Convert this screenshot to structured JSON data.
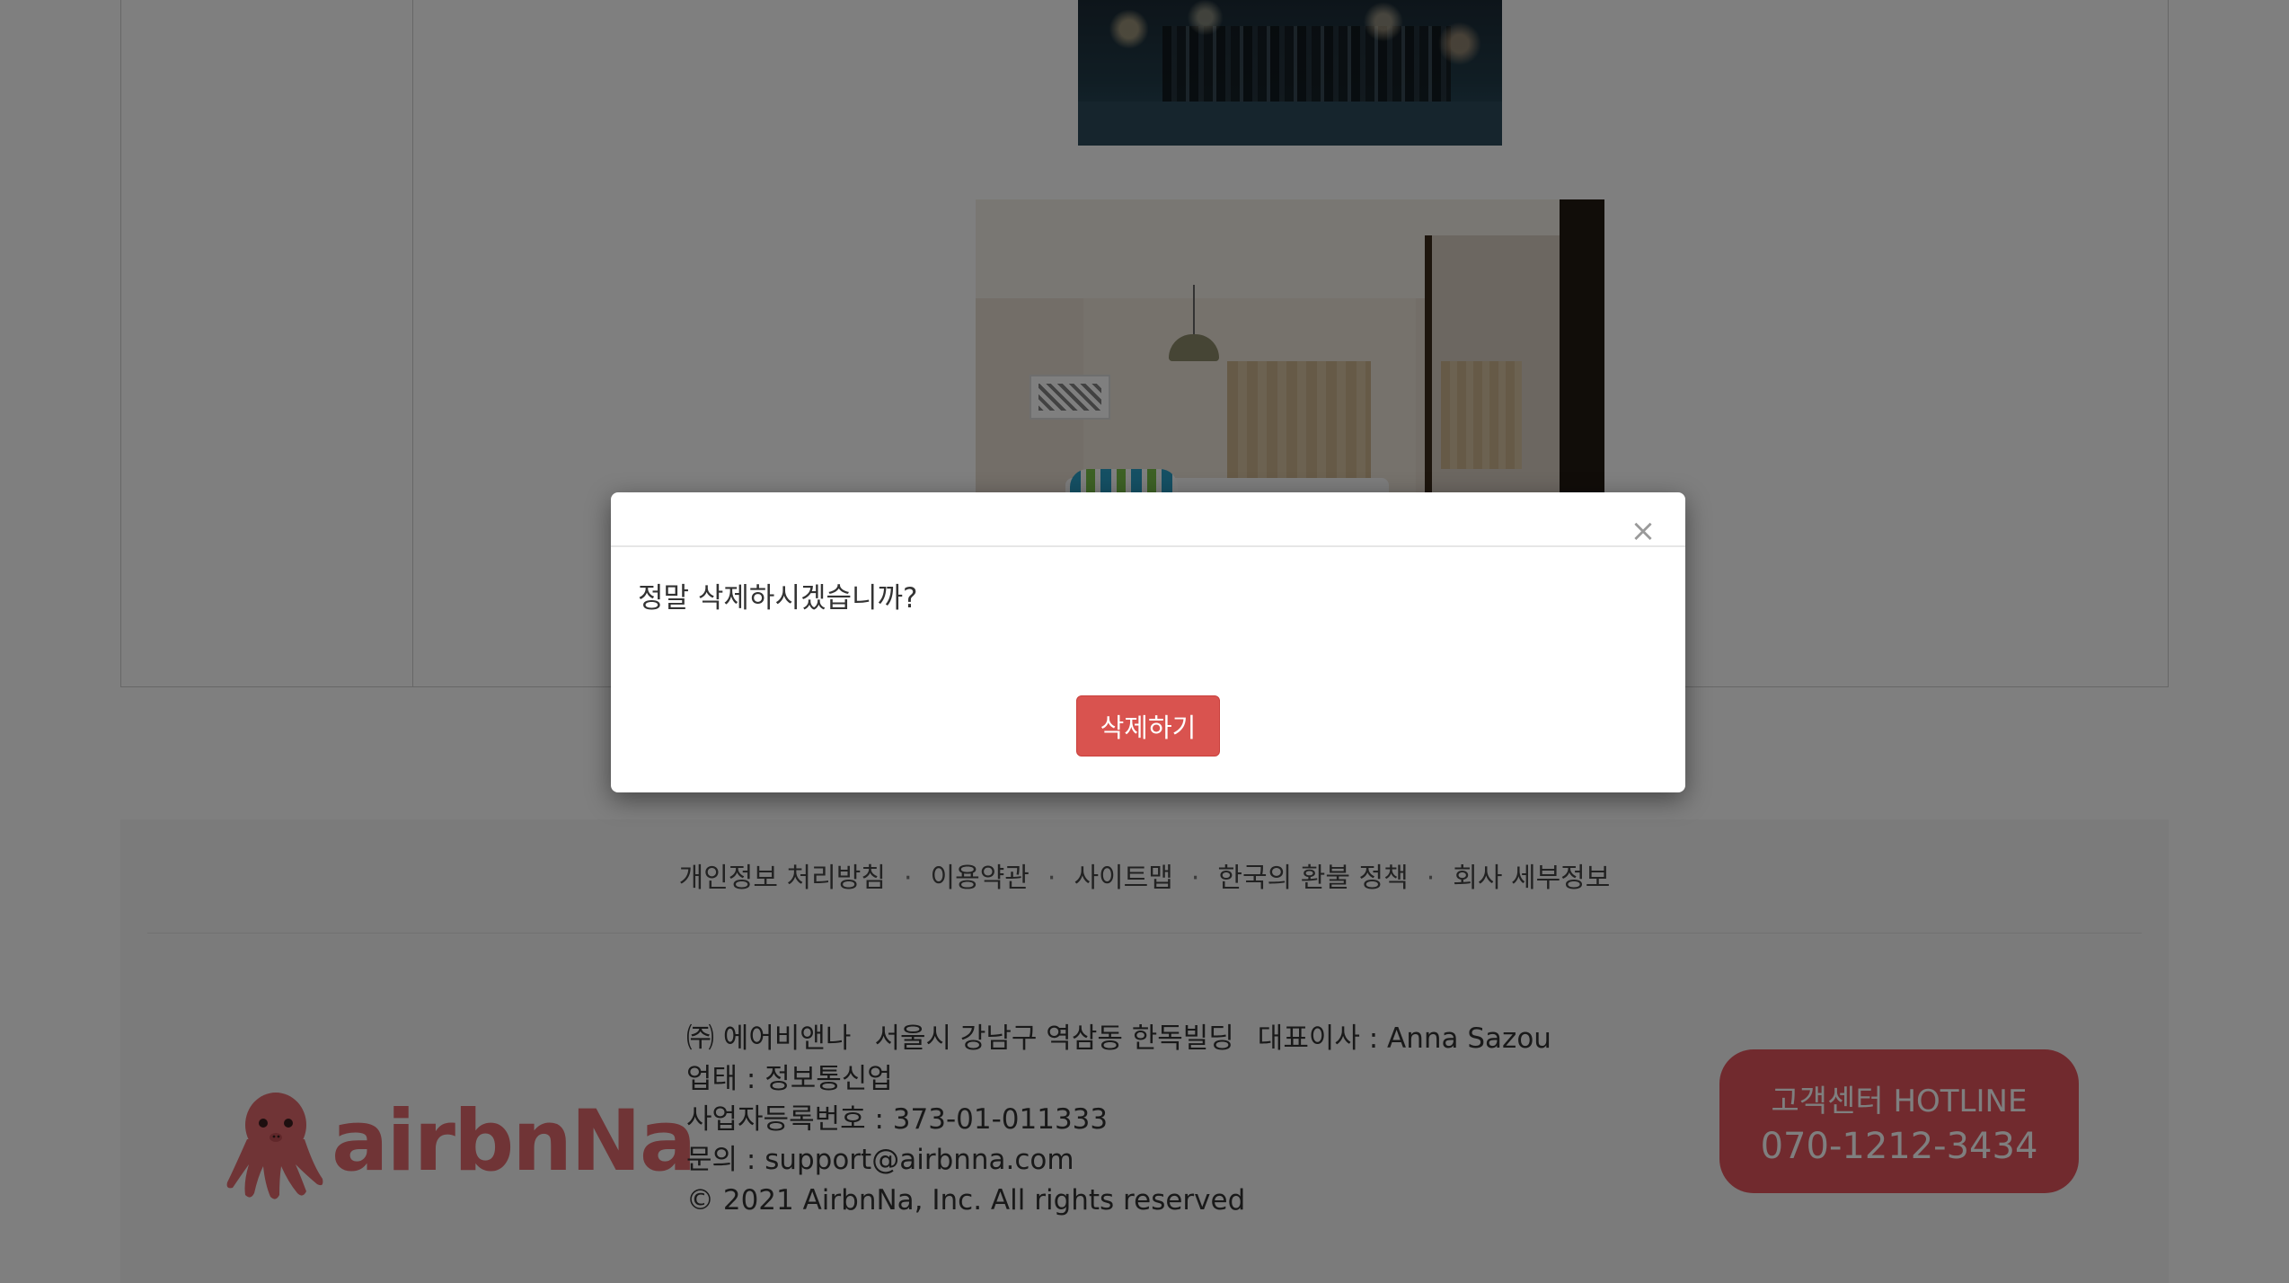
{
  "footer": {
    "links": [
      "개인정보 처리방침",
      "이용약관",
      "사이트맵",
      "한국의 환불 정책",
      "회사 세부정보"
    ],
    "link_separator": "·",
    "company": {
      "line1_name": "㈜ 에어비앤나",
      "line1_address": "서울시 강남구 역삼동 한독빌딩",
      "line1_ceo": "대표이사 : Anna Sazou",
      "business_type": "업태 : 정보통신업",
      "registration": "사업자등록번호 : 373-01-011333",
      "contact": "문의 : support@airbnna.com",
      "copyright": "© 2021 AirbnNa, Inc. All rights reserved"
    },
    "logo_text": "airbnNa",
    "hotline": {
      "label": "고객센터 HOTLINE",
      "number": "070-1212-3434"
    }
  },
  "modal": {
    "close_symbol": "×",
    "message": "정말 삭제하시겠습니까?",
    "confirm_label": "삭제하기",
    "confirm_color": "#d9534f"
  },
  "colors": {
    "brand": "#e0686c",
    "backdrop": "rgba(0,0,0,0.5)"
  }
}
